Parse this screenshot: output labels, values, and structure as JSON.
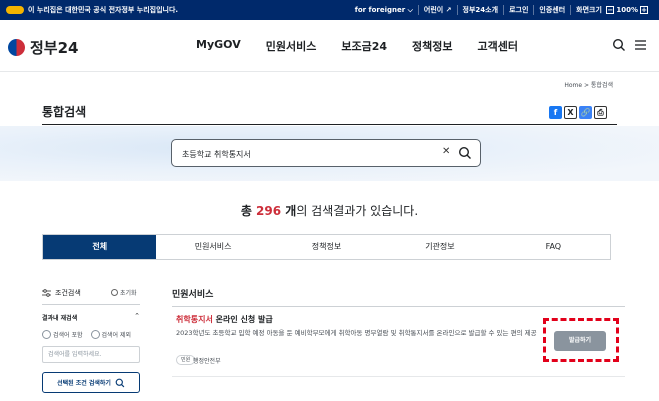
{
  "topbar": {
    "notice": "이 누리집은 대한민국 공식 전자정부 누리집입니다.",
    "links": [
      "for foreigner ⌵",
      "어린이 ↗",
      "정부24소개",
      "로그인",
      "인증센터",
      "화면크기"
    ],
    "zoom_minus": "−",
    "zoom_level": "100%",
    "zoom_plus": "+"
  },
  "header": {
    "logo_text": "정부24",
    "nav": [
      "MyGOV",
      "민원서비스",
      "보조금24",
      "정책정보",
      "고객센터"
    ]
  },
  "breadcrumb": "Home  >  통합검색",
  "page_title": "통합검색",
  "share": {
    "facebook": "f",
    "x": "X",
    "link": "🔗",
    "print": "⎙"
  },
  "search": {
    "query": "초등학교 취학통지서",
    "clear": "✕"
  },
  "summary": {
    "prefix": "총 ",
    "count": "296",
    "unit": " 개",
    "suffix": "의 검색결과가 있습니다."
  },
  "tabs": [
    "전체",
    "민원서비스",
    "정책정보",
    "기관정보",
    "FAQ"
  ],
  "sidebar": {
    "filter_title": "조건검색",
    "reset": "초기화",
    "within_title": "결과내 재검색",
    "within_chevron": "⌃",
    "radio_include": "검색어 포함",
    "radio_exclude": "검색어 제외",
    "within_placeholder": "검색어를 입력하세요.",
    "apply_button": "선택된 조건 검색하기"
  },
  "results": {
    "section_title": "민원서비스",
    "items": [
      {
        "title_highlight": "취학통지서",
        "title_rest": " 온라인 신청 발급",
        "desc": "2023학년도 초등학교 입학 예정 아동을 둔 예비학부모에게 취학아동 명부열람 및 취학통지서를 온라인으로 발급할 수 있는 편의 제공",
        "tag": "민원",
        "agency": "행정안전부",
        "action": "발급하기"
      }
    ]
  },
  "colors": {
    "topbar": "#00296b",
    "active_tab": "#063a74",
    "highlight": "#cd2e3a",
    "annotation": "#e2001a"
  }
}
